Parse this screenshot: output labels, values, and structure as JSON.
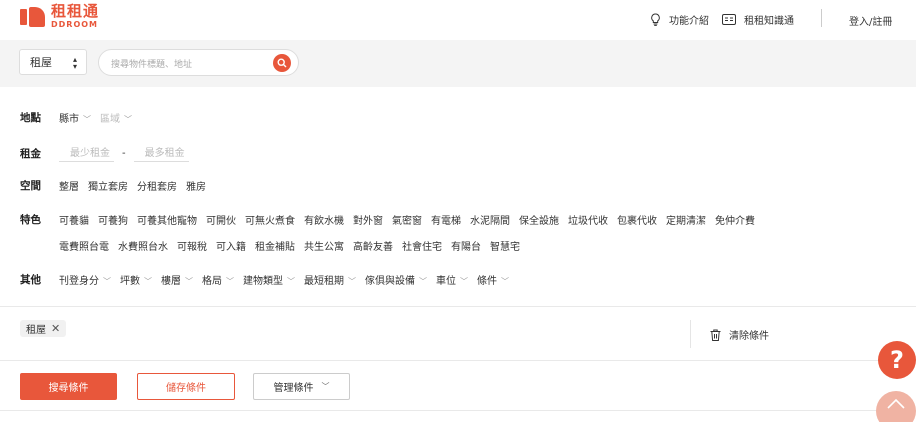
{
  "header": {
    "logo_cn": "租租通",
    "logo_en": "DDROOM",
    "nav": [
      {
        "label": "功能介紹",
        "icon": "lightbulb-icon"
      },
      {
        "label": "租租知識通",
        "icon": "book-icon"
      }
    ],
    "login_label": "登入/註冊"
  },
  "search": {
    "type_value": "租屋",
    "placeholder": "搜尋物件標題、地址",
    "button_icon": "search-icon"
  },
  "filters": {
    "location": {
      "label": "地點",
      "city": "縣市",
      "district": "區域"
    },
    "rent": {
      "label": "租金",
      "min_placeholder": "最少租金",
      "separator": "-",
      "max_placeholder": "最多租金"
    },
    "space": {
      "label": "空間",
      "options": [
        "整層",
        "獨立套房",
        "分租套房",
        "雅房"
      ]
    },
    "features": {
      "label": "特色",
      "options_row1": [
        "可養貓",
        "可養狗",
        "可養其他寵物",
        "可開伙",
        "可無火煮食",
        "有飲水機",
        "對外窗",
        "氣密窗",
        "有電梯",
        "水泥隔間",
        "保全設施",
        "垃圾代收",
        "包裹代收",
        "定期清潔",
        "免仲介費"
      ],
      "options_row2": [
        "電費照台電",
        "水費照台水",
        "可報稅",
        "可入籍",
        "租金補貼",
        "共生公寓",
        "高齡友善",
        "社會住宅",
        "有陽台",
        "智慧宅"
      ]
    },
    "other": {
      "label": "其他",
      "options": [
        "刊登身分",
        "坪數",
        "樓層",
        "格局",
        "建物類型",
        "最短租期",
        "傢俱與設備",
        "車位",
        "條件"
      ]
    }
  },
  "selected": {
    "chips": [
      "租屋"
    ],
    "clear_label": "清除條件"
  },
  "actions": {
    "search_label": "搜尋條件",
    "save_label": "儲存條件",
    "manage_label": "管理條件"
  },
  "floating": {
    "help": "?"
  },
  "colors": {
    "brand": "#e8573b"
  }
}
